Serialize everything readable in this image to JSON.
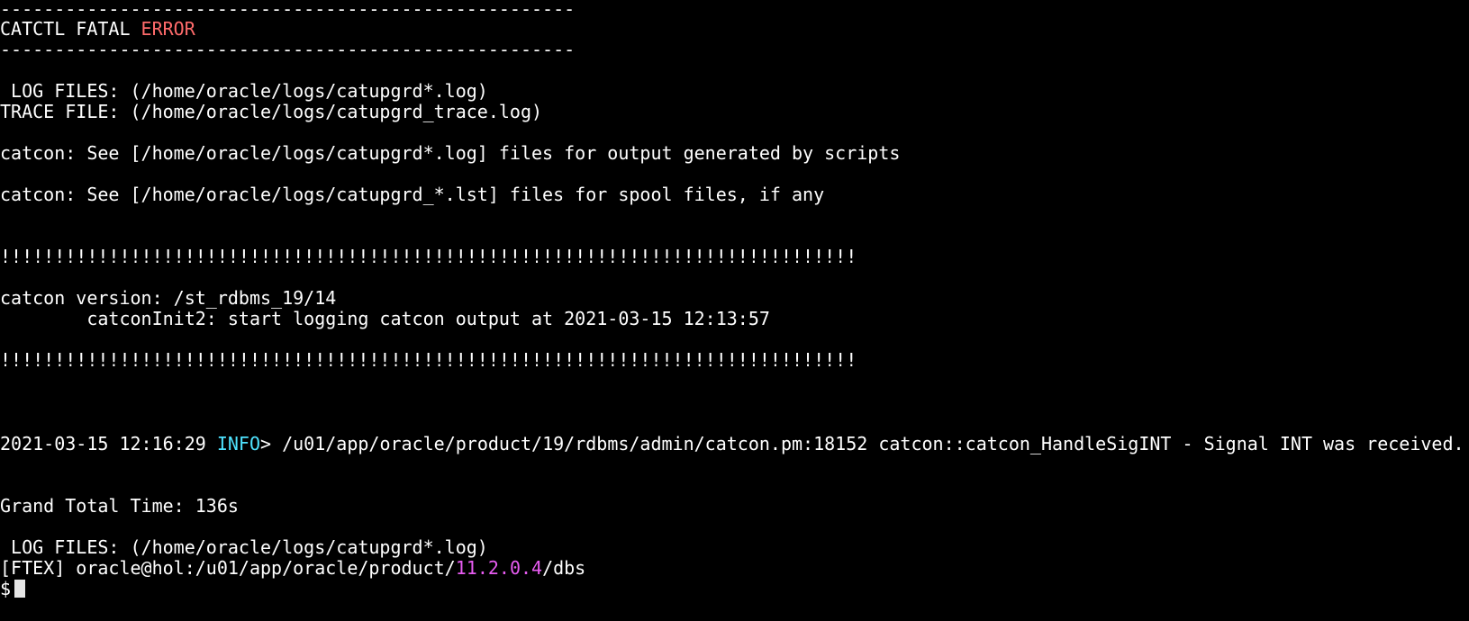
{
  "terminal": {
    "dash_line": "-----------------------------------------------------",
    "fatal_prefix": "CATCTL FATAL ",
    "fatal_error_word": "ERROR",
    "log_files": " LOG FILES: (/home/oracle/logs/catupgrd*.log)",
    "trace_file": "TRACE FILE: (/home/oracle/logs/catupgrd_trace.log)",
    "catcon_see_log": "catcon: See [/home/oracle/logs/catupgrd*.log] files for output generated by scripts",
    "catcon_see_lst": "catcon: See [/home/oracle/logs/catupgrd_*.lst] files for spool files, if any",
    "bang_line": "!!!!!!!!!!!!!!!!!!!!!!!!!!!!!!!!!!!!!!!!!!!!!!!!!!!!!!!!!!!!!!!!!!!!!!!!!!!!!!!",
    "catcon_version": "catcon version: /st_rdbms_19/14",
    "catcon_init": "        catconInit2: start logging catcon output at 2021-03-15 12:13:57",
    "info_timestamp": "2021-03-15 12:16:29 ",
    "info_level": "INFO",
    "info_message": "> /u01/app/oracle/product/19/rdbms/admin/catcon.pm:18152 catcon::catcon_HandleSigINT - Signal INT was received.",
    "grand_total": "Grand Total Time: 136s",
    "log_files_2": " LOG FILES: (/home/oracle/logs/catupgrd*.log)",
    "prompt_prefix": "[FTEX] oracle@hol:/u01/app/oracle/product/",
    "prompt_version": "11.2.0.4",
    "prompt_suffix": "/dbs",
    "prompt_symbol": "$"
  },
  "colors": {
    "background": "#000000",
    "text": "#ffffff",
    "error": "#ff6b6b",
    "info": "#4fe3ff",
    "magenta": "#e85cf2"
  }
}
